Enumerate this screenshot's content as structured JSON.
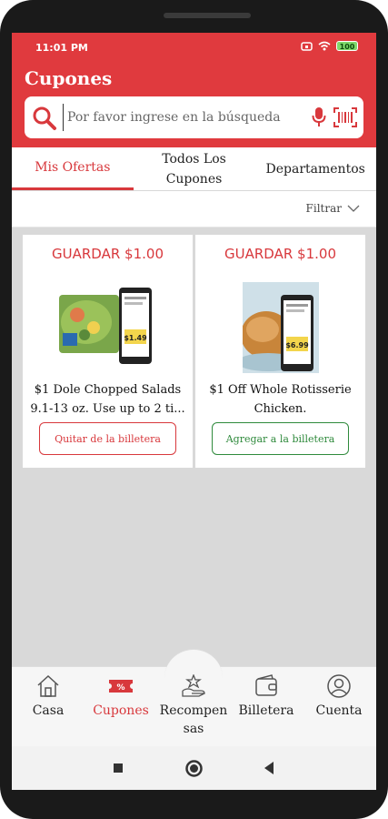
{
  "status_bar": {
    "time": "11:01 PM",
    "battery": "100"
  },
  "header": {
    "title": "Cupones"
  },
  "search": {
    "placeholder": "Por favor ingrese en la búsqueda"
  },
  "tabs": [
    {
      "label": "Mis Ofertas",
      "active": true
    },
    {
      "label": "Todos Los Cupones",
      "active": false
    },
    {
      "label": "Departamentos",
      "active": false
    }
  ],
  "filter": {
    "label": "Filtrar"
  },
  "coupons": [
    {
      "save": "GUARDAR $1.00",
      "description": "$1 Dole Chopped Salads 9.1-13 oz. Use up to 2 ti...",
      "button": "Quitar de la billetera",
      "image_price": "$1.49"
    },
    {
      "save": "GUARDAR $1.00",
      "description": "$1 Off Whole Rotisserie Chicken.",
      "button": "Agregar a la billetera",
      "image_price": "$6.99"
    }
  ],
  "bottom_nav": [
    {
      "label": "Casa",
      "icon": "home-icon"
    },
    {
      "label": "Cupones",
      "icon": "coupon-icon",
      "active": true
    },
    {
      "label": "Recompensas",
      "icon": "rewards-icon"
    },
    {
      "label": "Billetera",
      "icon": "wallet-icon"
    },
    {
      "label": "Cuenta",
      "icon": "account-icon"
    }
  ],
  "colors": {
    "brand_red": "#e03a3e",
    "active_red": "#d8383c",
    "add_green": "#2f8a3c"
  }
}
